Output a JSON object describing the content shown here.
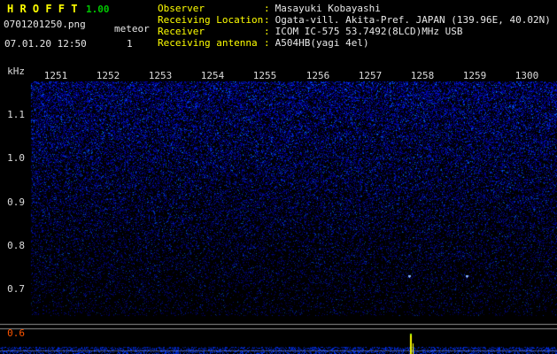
{
  "header": {
    "title": "H R O F F T",
    "version": "1.00",
    "filename": "0701201250.png",
    "mode": "meteor",
    "datetime": "07.01.20 12:50",
    "count": "1"
  },
  "info": {
    "separator": ":",
    "rows": [
      {
        "label": "Observer",
        "value": "Masayuki Kobayashi"
      },
      {
        "label": "Receiving Location",
        "value": "Ogata-vill. Akita-Pref. JAPAN (139.96E, 40.02N)"
      },
      {
        "label": "Receiver",
        "value": "ICOM IC-575 53.7492(8LCD)MHz USB"
      },
      {
        "label": "Receiving antenna",
        "value": "A504HB(yagi 4el)"
      }
    ]
  },
  "chart_data": {
    "type": "heatmap",
    "title": "HROFFT 10-minute radio meteor spectrogram",
    "x_ticks": [
      "1251",
      "1252",
      "1253",
      "1254",
      "1255",
      "1256",
      "1257",
      "1258",
      "1259",
      "1300"
    ],
    "y_axis_unit": "kHz",
    "y_ticks": [
      "1.1",
      "1.0",
      "0.9",
      "0.8",
      "0.7",
      "0.6"
    ],
    "y_range_khz": [
      0.55,
      1.18
    ],
    "time_range": [
      "12:51",
      "13:00"
    ],
    "content_note": "diffuse blue background noise, densest at high frequency, fading toward low frequency; no strong meteor echo trails; meteor count 1",
    "echo_marks": [
      {
        "x": 461,
        "y": 311,
        "time": "~12:58",
        "freq_khz": 0.73
      },
      {
        "x": 526,
        "y": 311,
        "time": "~12:59",
        "freq_khz": 0.73
      }
    ],
    "level_strip": {
      "threshold_line_y": [
        366,
        371
      ],
      "noise_band_y": [
        392,
        400
      ],
      "spike": {
        "x": 463,
        "top": 377,
        "color": "#ffff00"
      }
    }
  },
  "colors": {
    "bg": "#000000",
    "title-yellow": "#ffff00",
    "version-green": "#00c800",
    "label-yellow": "#ffff00",
    "text-white": "#e8e8e8",
    "tick-white": "#dcdcdc",
    "tick-red": "#ff5500",
    "noise-blue": "#2233ff"
  }
}
